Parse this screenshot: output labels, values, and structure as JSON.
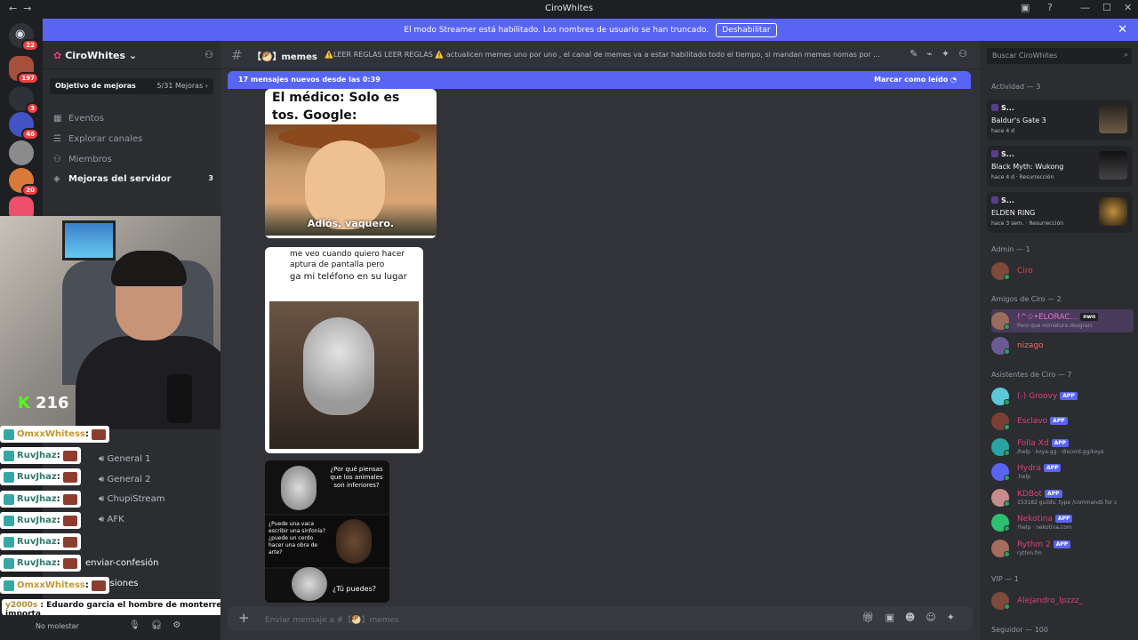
{
  "window": {
    "title": "CiroWhites"
  },
  "banner": {
    "text": "El modo Streamer está habilitado. Los nombres de usuario se han truncado.",
    "button": "Deshabilitar"
  },
  "rail": {
    "badges": [
      "22",
      "197",
      "3",
      "46",
      "20"
    ]
  },
  "sidebar": {
    "server_name": "CiroWhites",
    "boost_goal": "Objetivo de mejoras",
    "boost_progress": "5/31 Mejoras",
    "nav": [
      {
        "label": "Eventos"
      },
      {
        "label": "Explorar canales"
      },
      {
        "label": "Miembros"
      },
      {
        "label": "Mejoras del servidor",
        "count": "3"
      }
    ],
    "voice_channels": [
      "General 1",
      "General 2",
      "ChupiStream",
      "AFK"
    ],
    "text_channels": [
      "enviar-confesión",
      "confesiones"
    ]
  },
  "stream": {
    "kick_count": "216",
    "chat": [
      {
        "user": "OmxxWhitess",
        "color": "#c9962a"
      },
      {
        "user": "RuvJhaz",
        "color": "#2f7a6d"
      },
      {
        "user": "RuvJhaz",
        "color": "#2f7a6d"
      },
      {
        "user": "RuvJhaz",
        "color": "#2f7a6d"
      },
      {
        "user": "RuvJhaz",
        "color": "#2f7a6d"
      },
      {
        "user": "RuvJhaz",
        "color": "#2f7a6d"
      },
      {
        "user": "RuvJhaz",
        "color": "#2f7a6d"
      },
      {
        "user": "OmxxWhitess",
        "color": "#c9962a"
      }
    ],
    "last_chat_user": "y2000s",
    "last_chat_text": ": Eduardo garcia el hombre de monterrey, no le importa"
  },
  "user_panel": {
    "status": "No molestar"
  },
  "channel": {
    "name": "【🥙】memes",
    "topic": "⚠️LEER REGLAS LEER REGLAS ⚠️ actualicen memes uno por uno , el canal de memes va a estar habilitado todo el tiempo, si mandan memes nomas por ...",
    "new_messages": "17 mensajes nuevos desde las 0:39",
    "mark_read": "Marcar como leído",
    "composer_placeholder": "Enviar mensaje a #【🥙】memes"
  },
  "memes": {
    "m1_top": "El médico: Solo es tos. Google:",
    "m1_caption": "Adiós, vaquero.",
    "m2_line1": "me veo cuando quiero hacer",
    "m2_line2": "aptura de pantalla pero",
    "m2_line3": "ga mi teléfono en su lugar",
    "m3_q1": "¿Por qué piensas que los animales son inferiores?",
    "m3_q2": "¿Puede una vaca escribir una sinfonía? ¿puede un cerdo hacer una obra de arte?",
    "m3_q3": "¿Tú puedes?"
  },
  "members": {
    "search_placeholder": "Buscar CiroWhites",
    "activity_header": "Actividad — 3",
    "activities": [
      {
        "user": "S...",
        "game": "Baldur's Gate 3",
        "sub": "hace 4 d"
      },
      {
        "user": "S...",
        "game": "Black Myth: Wukong",
        "sub": "hace 4 d · Resurrección"
      },
      {
        "user": "S...",
        "game": "ELDEN RING",
        "sub": "hace 3 sem. · Resurrección"
      }
    ],
    "sections": [
      {
        "header": "Admin — 1",
        "items": [
          {
            "name": "Ciro",
            "color": "#f23f43",
            "sub": ""
          }
        ]
      },
      {
        "header": "Amigos de Ciro — 2",
        "items": [
          {
            "name": "!^✩•ELORAC...",
            "color": "#e573c9",
            "sub": "Pero que miniatura desgraci",
            "tag": "nwn"
          },
          {
            "name": "nizago",
            "color": "#f26b6b",
            "sub": ""
          }
        ]
      },
      {
        "header": "Asistentes de Ciro — 7",
        "items": [
          {
            "name": "(-) Groovy",
            "color": "#e0407d",
            "sub": "",
            "app": "APP"
          },
          {
            "name": "Esclavo",
            "color": "#e0407d",
            "sub": "",
            "app": "APP"
          },
          {
            "name": "Folla Xd",
            "color": "#e0407d",
            "sub": "/help · koya.gg · discord.gg/koya",
            "app": "APP"
          },
          {
            "name": "Hydra",
            "color": "#e0407d",
            "sub": ".help",
            "app": "APP"
          },
          {
            "name": "KDBot",
            "color": "#e0407d",
            "sub": "153182 guilds; type /commands for c",
            "app": "APP"
          },
          {
            "name": "Nekotina",
            "color": "#e0407d",
            "sub": "!help · nekotina.com",
            "app": "APP"
          },
          {
            "name": "Rythm 2",
            "color": "#e0407d",
            "sub": "rythm.fm",
            "app": "APP"
          }
        ]
      },
      {
        "header": "VIP — 1",
        "items": [
          {
            "name": "Alejandro_lpzzz_",
            "color": "#e0407d",
            "sub": ""
          }
        ]
      }
    ],
    "followers_header": "Seguidor — 100"
  }
}
